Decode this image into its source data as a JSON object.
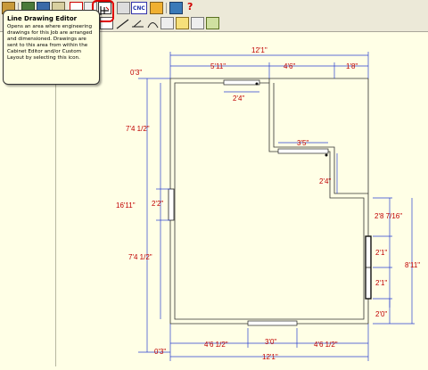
{
  "tooltip": {
    "title": "Line Drawing Editor",
    "body": "Opens an area where engineering drawings for this Job are arranged and dimensioned. Drawings are sent to this area from within the Cabinet Editor and/or Custom Layout by selecting this icon."
  },
  "toolbar": {
    "cnc_label": "CNC",
    "help_label": "?"
  },
  "dimensions": {
    "top_overall": "12'1\"",
    "top_left": "5'11\"",
    "top_mid": "4'6\"",
    "top_right": "1'8\"",
    "top_offset": "0'3\"",
    "upper_window": "2'4\"",
    "left_upper": "7'4 1/2\"",
    "left_total": "16'11\"",
    "left_window": "2'2\"",
    "left_lower": "7'4 1/2\"",
    "inner_step": "3'5\"",
    "inner_window": "2'4\"",
    "right_upper": "2'8 7/16\"",
    "right_total": "8'11\"",
    "right_win_a": "2'1\"",
    "right_win_b": "2'1\"",
    "right_lower": "2'0\"",
    "bottom_offset": "0'3\"",
    "bottom_left": "4'6 1/2\"",
    "bottom_mid": "3'0\"",
    "bottom_right": "4'6 1/2\"",
    "bottom_overall": "12'1\""
  }
}
